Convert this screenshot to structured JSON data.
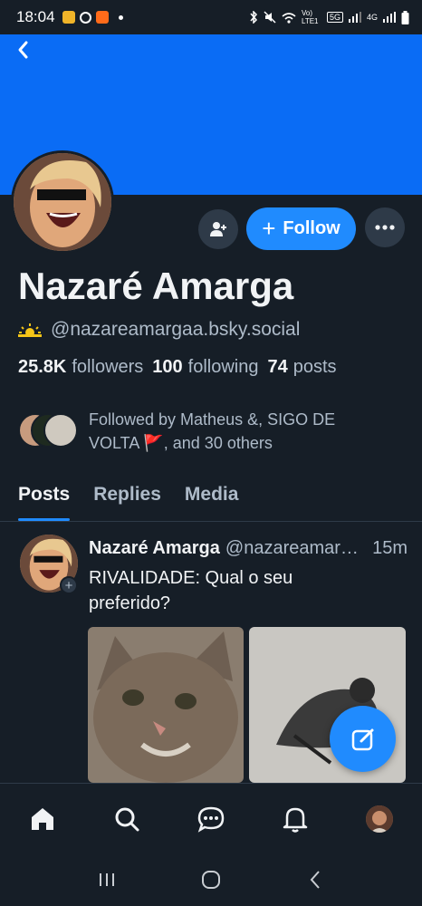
{
  "status_bar": {
    "time": "18:04",
    "network_label_1": "Vo) LTE1",
    "network_label_2": "5G",
    "network_label_3": "4G",
    "icons": [
      "app-notification-icon",
      "reddit-icon",
      "app-icon",
      "bluetooth-icon",
      "mute-icon",
      "wifi-icon",
      "signal-icon",
      "signal-icon",
      "battery-icon"
    ]
  },
  "header": {
    "back_icon": "chevron-left-icon"
  },
  "profile": {
    "display_name": "Nazaré Amarga",
    "handle": "@nazareamargaa.bsky.social",
    "followers_count": "25.8K",
    "followers_label": "followers",
    "following_count": "100",
    "following_label": "following",
    "posts_count": "74",
    "posts_label": "posts",
    "followed_by": "Followed by Matheus &, SIGO DE VOLTA 🚩, and 30 others"
  },
  "actions": {
    "follow_label": "Follow",
    "add_user_icon": "add-user-icon",
    "more_icon": "more-icon"
  },
  "tabs": [
    {
      "label": "Posts",
      "active": true
    },
    {
      "label": "Replies",
      "active": false
    },
    {
      "label": "Media",
      "active": false
    }
  ],
  "post": {
    "author_name": "Nazaré Amarga",
    "author_handle": "@nazareamargaa.bsky.social",
    "time": "15m",
    "text": "RIVALIDADE: Qual o seu preferido?"
  },
  "bottom_nav": [
    "home-icon",
    "search-icon",
    "chat-icon",
    "bell-icon",
    "profile-avatar"
  ],
  "colors": {
    "background": "#161e27",
    "banner": "#0a6cf5",
    "accent": "#208bfe",
    "muted_text": "#aebbc9",
    "surface": "#2e3a48"
  }
}
